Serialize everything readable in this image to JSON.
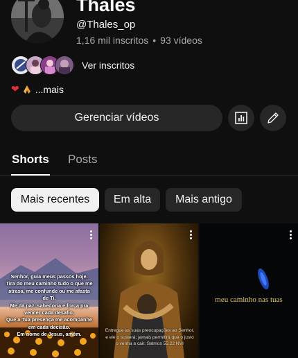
{
  "channel": {
    "name": "Thales",
    "handle": "@Thales_op",
    "subscribers": "1,16 mil inscritos",
    "separator": "•",
    "videos": "93 vídeos",
    "view_subscribers_label": "Ver inscritos",
    "description_suffix": "...mais"
  },
  "actions": {
    "manage_videos_label": "Gerenciar vídeos",
    "analytics_icon": "analytics-icon",
    "edit_icon": "pencil-icon"
  },
  "tabs": [
    {
      "label": "Shorts",
      "selected": true
    },
    {
      "label": "Posts",
      "selected": false
    }
  ],
  "filters": [
    {
      "label": "Mais recentes",
      "selected": true
    },
    {
      "label": "Em alta",
      "selected": false
    },
    {
      "label": "Mais antigo",
      "selected": false
    }
  ],
  "shorts": [
    {
      "overlay_text": "Senhor, guia meus passos hoje.\nTira do meu caminho tudo o que me\natrasa, me confunde ou me afasta\nde Ti.\nMe dá paz, sabedoria e força pra\nvencer cada desafio.\nQue a Tua presença me acompanhe\nem cada decisão.\nEm nome de Jesus, amém."
    },
    {
      "overlay_text": "Entregue as suas preocupações ao Senhor,\ne ele o susterá; jamais permitirá que o justo\no venha a cair. Salmos 55:22 NVI"
    },
    {
      "overlay_text": "meu caminho nas tuas"
    }
  ],
  "colors": {
    "background": "#0f0f0f",
    "button_bg": "#272727",
    "selected_chip_bg": "#f1f1f1",
    "secondary_text": "#aaaaaa",
    "accent_gold": "#e8c766"
  }
}
